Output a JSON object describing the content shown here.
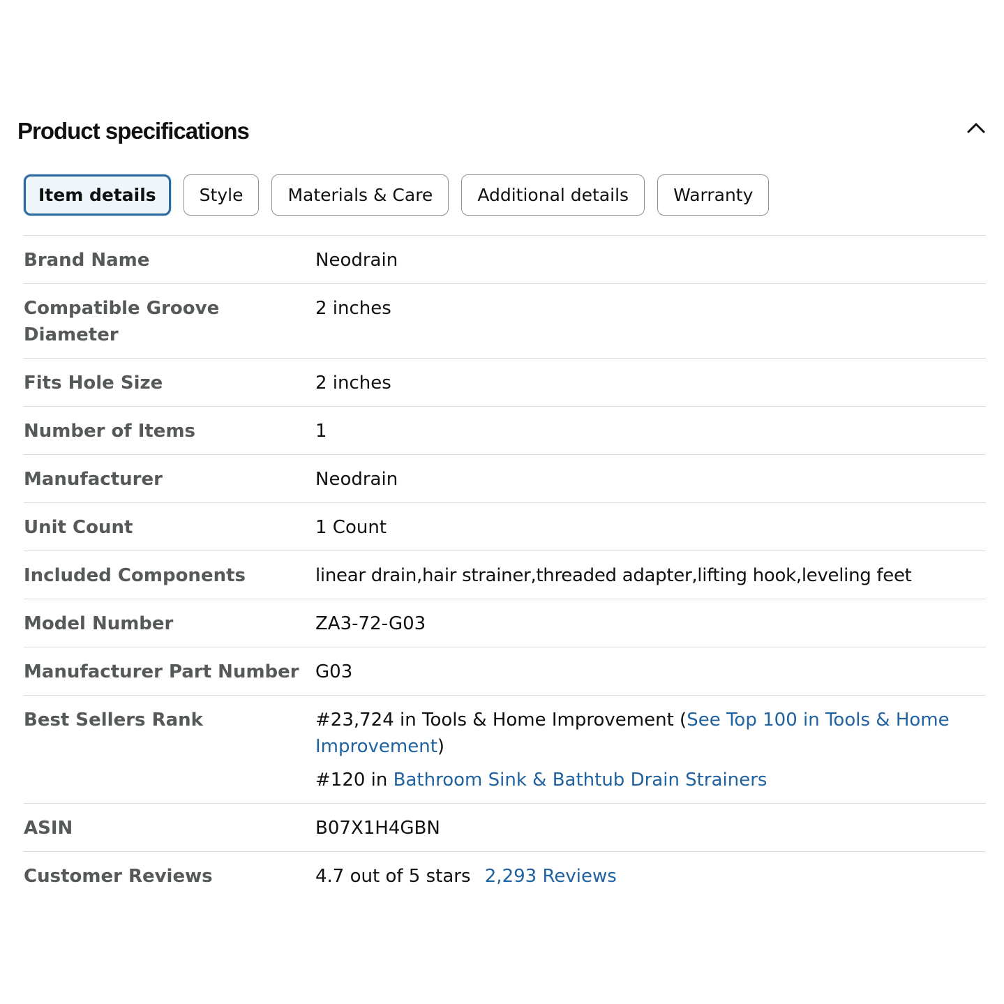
{
  "header": {
    "title": "Product specifications",
    "collapse_icon": "chevron-up-icon"
  },
  "tabs": [
    {
      "label": "Item details",
      "active": true
    },
    {
      "label": "Style",
      "active": false
    },
    {
      "label": "Materials & Care",
      "active": false
    },
    {
      "label": "Additional details",
      "active": false
    },
    {
      "label": "Warranty",
      "active": false
    }
  ],
  "specs": {
    "brand_name": {
      "label": "Brand Name",
      "value": "Neodrain"
    },
    "groove_diameter": {
      "label": "Compatible Groove Diameter",
      "value": "2 inches"
    },
    "hole_size": {
      "label": "Fits Hole Size",
      "value": "2 inches"
    },
    "number_of_items": {
      "label": "Number of Items",
      "value": "1"
    },
    "manufacturer": {
      "label": "Manufacturer",
      "value": "Neodrain"
    },
    "unit_count": {
      "label": "Unit Count",
      "value": "1 Count"
    },
    "included_components": {
      "label": "Included Components",
      "value": "linear drain,hair strainer,threaded adapter,lifting hook,leveling feet"
    },
    "model_number": {
      "label": "Model Number",
      "value": "ZA3-72-G03"
    },
    "part_number": {
      "label": "Manufacturer Part Number",
      "value": "G03"
    },
    "best_sellers_rank": {
      "label": "Best Sellers Rank",
      "line1_prefix": "#23,724 in Tools & Home Improvement (",
      "line1_link": "See Top 100 in Tools & Home Improvement",
      "line1_suffix": ")",
      "line2_prefix": "#120 in ",
      "line2_link": "Bathroom Sink & Bathtub Drain Strainers"
    },
    "asin": {
      "label": "ASIN",
      "value": "B07X1H4GBN"
    },
    "customer_reviews": {
      "label": "Customer Reviews",
      "rating_text": "4.7 out of 5 stars",
      "review_count": "2,293",
      "reviews_word": "Reviews"
    }
  },
  "colors": {
    "link": "#2162a1",
    "label": "#565959",
    "text": "#0f1111",
    "active_tab_border": "#2f6a9f",
    "divider": "#dddddd"
  }
}
